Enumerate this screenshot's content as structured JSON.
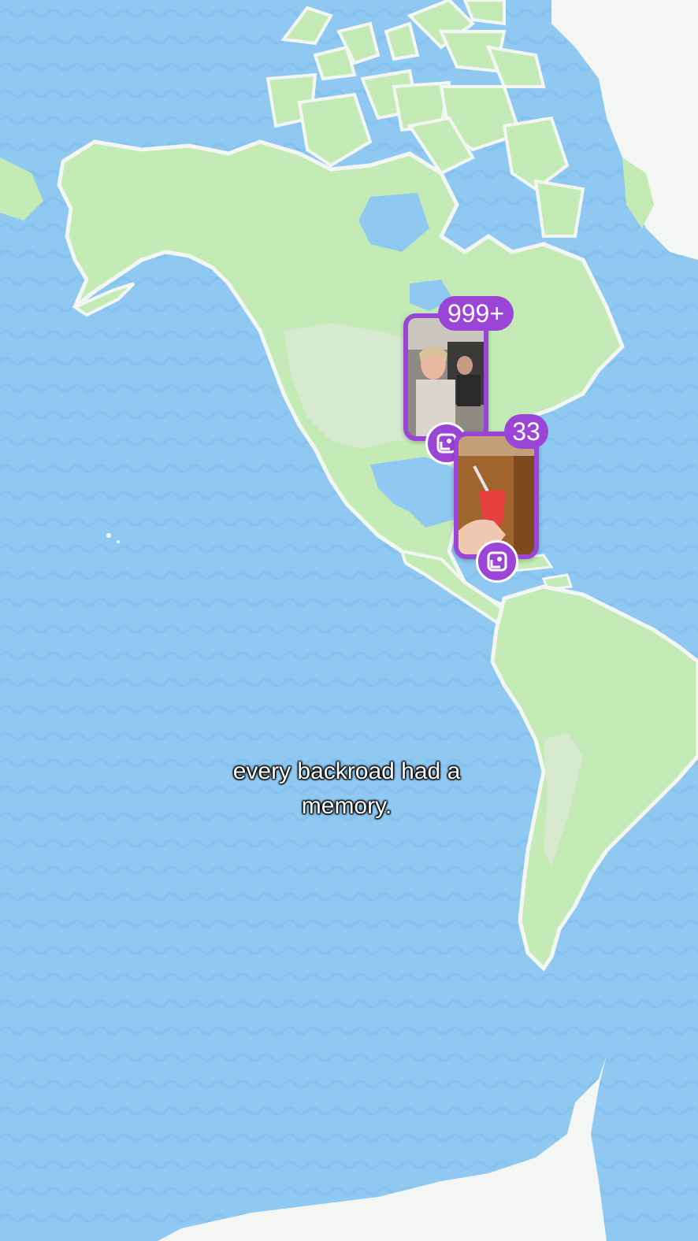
{
  "map": {
    "ocean_color": "#8fc9f1",
    "wave_color": "#7ebbe8",
    "land_color": "#c4ebb5",
    "land_shade_color": "#b3e2a3",
    "ice_color": "#f4f6f4"
  },
  "clusters": [
    {
      "id": "cluster-north-america",
      "count_label": "999+",
      "photo_subject": "selfie-in-car",
      "icon": "memories-icon"
    },
    {
      "id": "cluster-caribbean",
      "count_label": "33",
      "photo_subject": "red-drink-in-hand",
      "icon": "memories-icon"
    }
  ],
  "caption": {
    "line1": "every backroad had a",
    "line2": "memory."
  },
  "accent_color": "#9b45d6"
}
